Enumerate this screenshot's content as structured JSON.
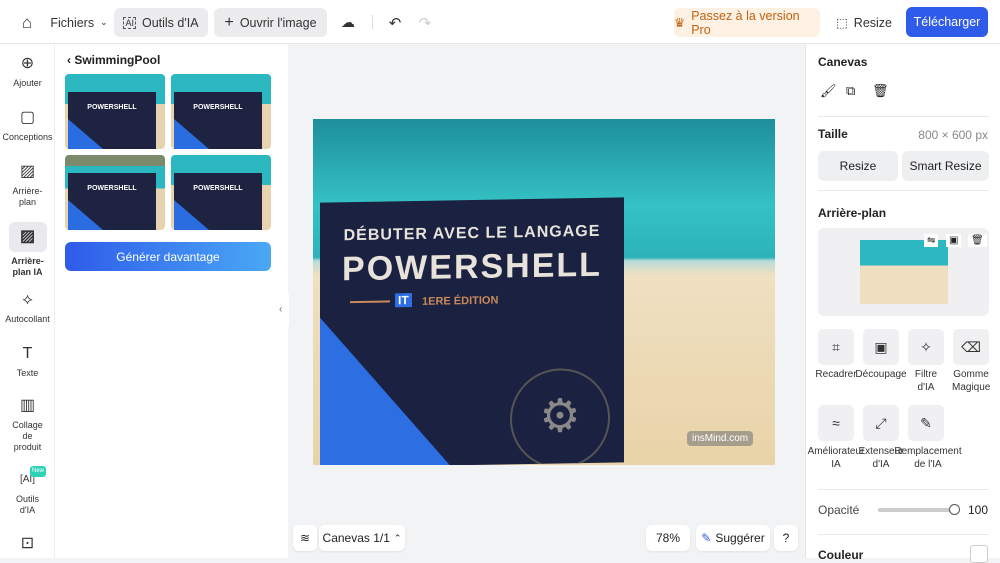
{
  "topbar": {
    "files": "Fichiers",
    "ai_tools": "Outils d'IA",
    "open_image": "Ouvrir l'image",
    "upgrade": "Passez à la version Pro",
    "resize": "Resize",
    "download": "Télécharger"
  },
  "rail": [
    {
      "label": "Ajouter",
      "icon": "plus-circle-icon"
    },
    {
      "label": "Conceptions",
      "icon": "designs-icon"
    },
    {
      "label": "Arrière-plan",
      "icon": "background-icon"
    },
    {
      "label": "Arrière-plan IA",
      "icon": "ai-background-icon"
    },
    {
      "label": "Autocollant",
      "icon": "sticker-icon"
    },
    {
      "label": "Texte",
      "icon": "text-icon"
    },
    {
      "label": "Collage de produit",
      "icon": "collage-icon"
    },
    {
      "label": "Outils d'IA",
      "icon": "ai-tools-icon",
      "badge": "New"
    }
  ],
  "panel": {
    "back_title": "SwimmingPool",
    "thumb_text": "POWERSHELL",
    "generate": "Générer davantage"
  },
  "canvas": {
    "cover_line1": "DÉBUTER AVEC LE LANGAGE",
    "cover_line2": "POWERSHELL",
    "cover_badge": "IT",
    "cover_edition": "1ERE ÉDITION",
    "watermark": "insMind.com"
  },
  "bottom": {
    "canvas_pages": "Canevas 1/1",
    "zoom": "78%",
    "suggest": "Suggérer",
    "help": "?"
  },
  "right": {
    "canvas_title": "Canevas",
    "size_label": "Taille",
    "size_value": "800 × 600 px",
    "resize": "Resize",
    "smart_resize": "Smart Resize",
    "background_title": "Arrière-plan",
    "tools": [
      {
        "label": "Recadrer",
        "icon": "crop-icon"
      },
      {
        "label": "Découpage",
        "icon": "cutout-icon"
      },
      {
        "label": "Filtre d'IA",
        "icon": "magic-wand-icon"
      },
      {
        "label": "Gomme Magique",
        "icon": "eraser-icon"
      },
      {
        "label": "Améliorateur IA",
        "icon": "enhance-icon"
      },
      {
        "label": "Extenseur d'IA",
        "icon": "expand-icon"
      },
      {
        "label": "Remplacement de l'IA",
        "icon": "replace-icon"
      }
    ],
    "opacity_label": "Opacité",
    "opacity_value": "100",
    "opacity": 100,
    "color_label": "Couleur"
  },
  "colors": {
    "accent": "#2f5bea",
    "upgrade_bg": "#fdf1e4",
    "upgrade_text": "#c0620f"
  }
}
